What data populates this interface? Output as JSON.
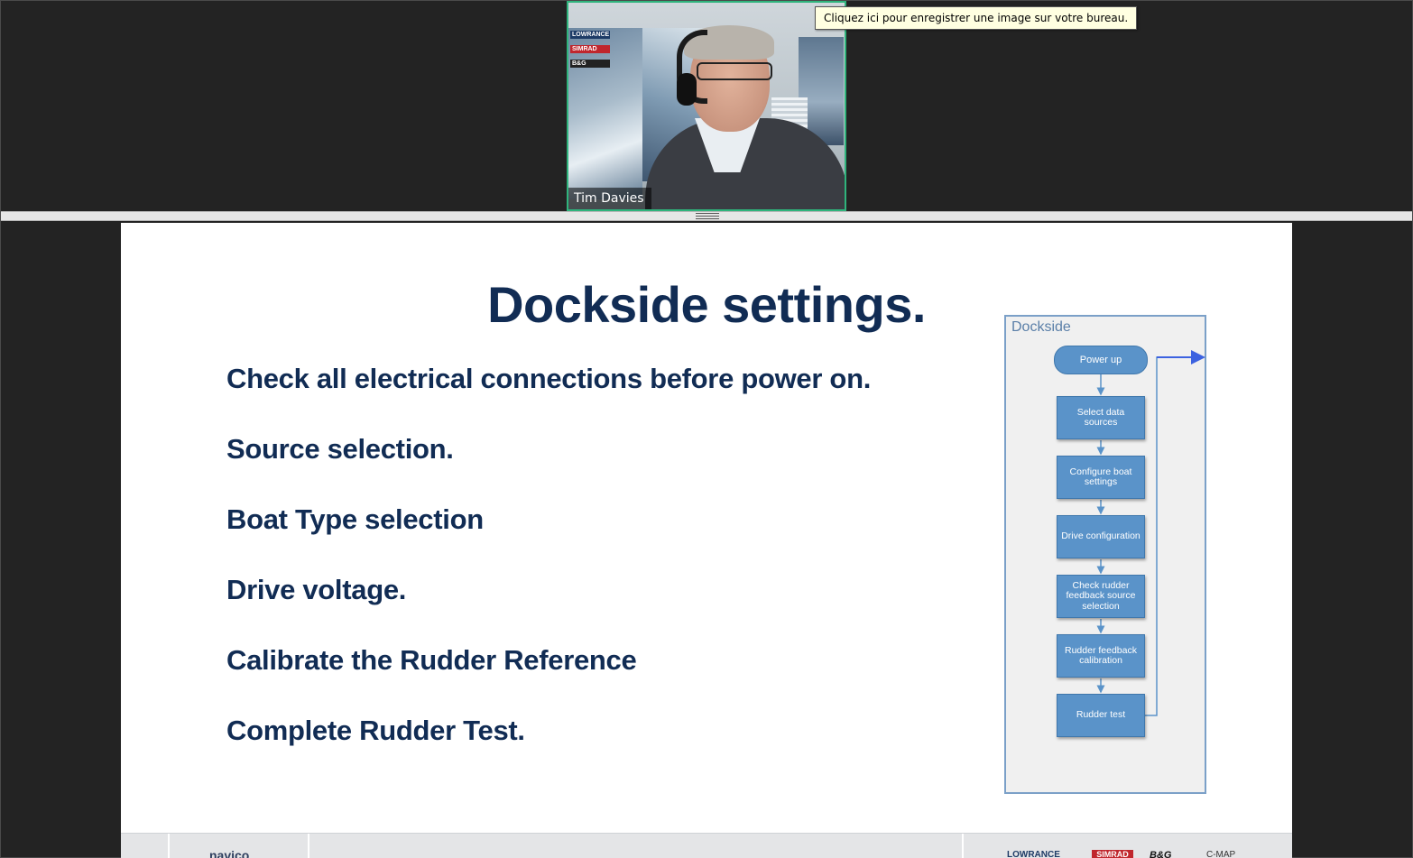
{
  "video": {
    "participant_name": "Tim Davies",
    "poster_labels": [
      "LOWRANCE",
      "SIMRAD",
      "B&G"
    ]
  },
  "tooltip": {
    "text": "Cliquez ici pour enregistrer une image sur votre bureau."
  },
  "slide": {
    "title": "Dockside settings.",
    "bullets": [
      "Check all electrical connections before power on.",
      "Source selection.",
      "Boat Type selection",
      "Drive voltage.",
      "Calibrate the Rudder Reference",
      "Complete Rudder Test."
    ],
    "flowchart": {
      "title": "Dockside",
      "start": "Power up",
      "steps": [
        "Select data sources",
        "Configure boat settings",
        "Drive configuration",
        "Check rudder feedback source selection",
        "Rudder feedback calibration",
        "Rudder test"
      ]
    },
    "footer": {
      "logo": "navico",
      "brands": [
        "LOWRANCE",
        "SIMRAD",
        "B&G",
        "C-MAP"
      ]
    }
  },
  "colors": {
    "background": "#232323",
    "speaker_border": "#2fb47c",
    "slide_text": "#112c54",
    "flow_box": "#5a93c9",
    "tooltip_bg": "#ffffe1"
  }
}
